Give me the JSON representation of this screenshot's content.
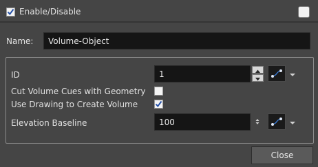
{
  "header": {
    "enable_label": "Enable/Disable",
    "enable_checked": true,
    "color_swatch": "#f2f2f2"
  },
  "name_row": {
    "label": "Name:",
    "value": "Volume-Object"
  },
  "properties": {
    "id_label": "ID",
    "id_value": "1",
    "cut_volume_label": "Cut Volume Cues with Geometry",
    "cut_volume_checked": false,
    "use_drawing_label": "Use Drawing to Create Volume",
    "use_drawing_checked": true,
    "elevation_label": "Elevation Baseline",
    "elevation_value": "100"
  },
  "footer": {
    "close_label": "Close"
  },
  "icons": [
    "checkmark-icon",
    "spin-up-icon",
    "spin-down-icon",
    "bezier-curve-icon",
    "dropdown-arrow-icon"
  ],
  "colors": {
    "background": "#454545",
    "field_background": "#151515",
    "accent_blue": "#3a7bd5"
  }
}
